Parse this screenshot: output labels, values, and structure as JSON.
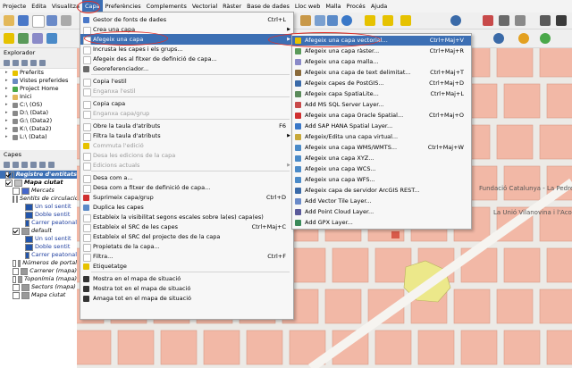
{
  "menubar": {
    "items": [
      "Projecte",
      "Edita",
      "Visualitza",
      "Capa",
      "Preferències",
      "Complements",
      "Vectorial",
      "Ràster",
      "Base de dades",
      "Lloc web",
      "Malla",
      "Procés",
      "Ajuda"
    ],
    "active": "Capa"
  },
  "browser": {
    "title": "Explorador",
    "items": [
      {
        "label": "Preferits",
        "icon": "star-icon",
        "color": "#e6c200"
      },
      {
        "label": "Vistes preferides",
        "icon": "spatial-bookmarks-icon",
        "color": "#6a8ac0"
      },
      {
        "label": "Project Home",
        "icon": "folder-green-icon",
        "color": "#4aa84a"
      },
      {
        "label": "Inici",
        "icon": "folder-icon",
        "color": "#e3b85a"
      },
      {
        "label": "C:\\ (OS)",
        "icon": "drive-icon",
        "color": "#888888"
      },
      {
        "label": "D:\\ (Data)",
        "icon": "drive-icon",
        "color": "#888888"
      },
      {
        "label": "G:\\ (Data2)",
        "icon": "drive-icon",
        "color": "#888888"
      },
      {
        "label": "K:\\ (Data2)",
        "icon": "drive-icon",
        "color": "#888888"
      },
      {
        "label": "L:\\ (Data)",
        "icon": "drive-icon",
        "color": "#888888"
      }
    ]
  },
  "layers": {
    "title": "Capes",
    "rows": [
      {
        "label": "Registre d'entitats",
        "style": "sel bold italic",
        "indent": 6,
        "checked": true,
        "swatch": "#3c6fb4"
      },
      {
        "label": "Mapa ciutat",
        "style": "bold italic",
        "indent": 6,
        "checked": true,
        "swatch": "#c0c0c0"
      },
      {
        "label": "Mercats",
        "style": "italic",
        "indent": 14,
        "checked": false,
        "swatch": "#4466cc"
      },
      {
        "label": "Sentits de circulació",
        "style": "italic",
        "indent": 14,
        "checked": false,
        "swatch": "#999999"
      },
      {
        "label": "Un sol sentit",
        "style": "blue",
        "indent": 28,
        "checked": null,
        "swatch": "#2255aa"
      },
      {
        "label": "Doble sentit",
        "style": "blue",
        "indent": 28,
        "checked": null,
        "swatch": "#2255aa"
      },
      {
        "label": "Carrer peatonal",
        "style": "blue",
        "indent": 28,
        "checked": null,
        "swatch": "#2255aa"
      },
      {
        "label": "default",
        "style": "italic",
        "indent": 14,
        "checked": true,
        "swatch": "#999999"
      },
      {
        "label": "Un sol sentit",
        "style": "blue",
        "indent": 28,
        "checked": null,
        "swatch": "#2255aa"
      },
      {
        "label": "Doble sentit",
        "style": "blue",
        "indent": 28,
        "checked": null,
        "swatch": "#2255aa"
      },
      {
        "label": "Carrer peatonal",
        "style": "blue",
        "indent": 28,
        "checked": null,
        "swatch": "#2255aa"
      },
      {
        "label": "Números de portal",
        "style": "italic",
        "indent": 14,
        "checked": false,
        "swatch": "#999999"
      },
      {
        "label": "Carrerer (mapa)",
        "style": "italic",
        "indent": 14,
        "checked": false,
        "swatch": "#999999"
      },
      {
        "label": "Toponímia (mapa)",
        "style": "italic",
        "indent": 14,
        "checked": false,
        "swatch": "#999999"
      },
      {
        "label": "Sectors (mapa)",
        "style": "italic",
        "indent": 14,
        "checked": false,
        "swatch": "#999999"
      },
      {
        "label": "Mapa ciutat",
        "style": "italic",
        "indent": 14,
        "checked": false,
        "swatch": "#999999"
      }
    ]
  },
  "capa_menu": {
    "items": [
      {
        "type": "item",
        "label": "Gestor de fonts de dades",
        "shortcut": "Ctrl+L",
        "icon": "data-source-manager-icon",
        "color": "#4a78c8"
      },
      {
        "type": "item",
        "label": "Crea una capa",
        "shortcut": "",
        "icon": "new-layer-icon",
        "color": "#ffffff",
        "submenu": true
      },
      {
        "type": "item",
        "label": "Afegeix una capa",
        "shortcut": "",
        "icon": "add-layer-icon",
        "color": "#ffffff",
        "submenu": true,
        "highlight": true
      },
      {
        "type": "item",
        "label": "Incrusta les capes i els grups...",
        "shortcut": "",
        "icon": "embed-icon",
        "color": "#ffffff"
      },
      {
        "type": "item",
        "label": "Afegeix des al fitxer de definició de capa...",
        "shortcut": "",
        "icon": "layer-definition-icon",
        "color": "#ffffff"
      },
      {
        "type": "item",
        "label": "Georeferenciador...",
        "shortcut": "",
        "icon": "georeferencer-icon",
        "color": "#6a6a6a"
      },
      {
        "type": "sep"
      },
      {
        "type": "item",
        "label": "Copia l'estil",
        "shortcut": "",
        "icon": "copy-style-icon",
        "color": "#ffffff"
      },
      {
        "type": "item",
        "label": "Enganxa l'estil",
        "shortcut": "",
        "icon": "paste-style-icon",
        "color": "#ffffff",
        "disabled": true
      },
      {
        "type": "sep"
      },
      {
        "type": "item",
        "label": "Copia capa",
        "shortcut": "",
        "icon": "copy-layer-icon",
        "color": "#ffffff"
      },
      {
        "type": "item",
        "label": "Enganxa capa/grup",
        "shortcut": "",
        "icon": "paste-layer-icon",
        "color": "#ffffff",
        "disabled": true
      },
      {
        "type": "sep"
      },
      {
        "type": "item",
        "label": "Obre la taula d'atributs",
        "shortcut": "F6",
        "icon": "attribute-table-icon",
        "color": "#ffffff"
      },
      {
        "type": "item",
        "label": "Filtra la taula d'atributs",
        "shortcut": "",
        "icon": "filter-table-icon",
        "color": "#ffffff",
        "submenu": true
      },
      {
        "type": "item",
        "label": "Commuta l'edició",
        "shortcut": "",
        "icon": "toggle-edit-icon",
        "color": "#e6c200",
        "disabled": true
      },
      {
        "type": "item",
        "label": "Desa les edicions de la capa",
        "shortcut": "",
        "icon": "save-edits-icon",
        "color": "#ffffff",
        "disabled": true
      },
      {
        "type": "item",
        "label": "Edicions actuals",
        "shortcut": "",
        "icon": "current-edits-icon",
        "color": "#ffffff",
        "disabled": true,
        "submenu": true
      },
      {
        "type": "sep"
      },
      {
        "type": "item",
        "label": "Desa com a...",
        "shortcut": "",
        "icon": "save-as-icon",
        "color": "#ffffff"
      },
      {
        "type": "item",
        "label": "Desa com a fitxer de definició de capa...",
        "shortcut": "",
        "icon": "save-definition-icon",
        "color": "#ffffff"
      },
      {
        "type": "item",
        "label": "Suprimeix capa/grup",
        "shortcut": "Ctrl+D",
        "icon": "remove-layer-icon",
        "color": "#d03030"
      },
      {
        "type": "item",
        "label": "Duplica les capes",
        "shortcut": "",
        "icon": "duplicate-layer-icon",
        "color": "#5a8ac8"
      },
      {
        "type": "item",
        "label": "Estableix la visibilitat segons escales sobre la(es) capa(es)",
        "shortcut": "",
        "icon": "scale-visibility-icon",
        "color": "#ffffff"
      },
      {
        "type": "item",
        "label": "Estableix el SRC de les capes",
        "shortcut": "Ctrl+Maj+C",
        "icon": "set-crs-icon",
        "color": "#ffffff"
      },
      {
        "type": "item",
        "label": "Estableix el SRC del projecte des de la capa",
        "shortcut": "",
        "icon": "project-crs-icon",
        "color": "#ffffff"
      },
      {
        "type": "item",
        "label": "Propietats de la capa...",
        "shortcut": "",
        "icon": "layer-properties-icon",
        "color": "#ffffff"
      },
      {
        "type": "item",
        "label": "Filtra...",
        "shortcut": "Ctrl+F",
        "icon": "filter-icon",
        "color": "#ffffff"
      },
      {
        "type": "item",
        "label": "Etiquetatge",
        "shortcut": "",
        "icon": "labeling-icon",
        "color": "#e6c200"
      },
      {
        "type": "sep"
      },
      {
        "type": "item",
        "label": "Mostra en el mapa de situació",
        "shortcut": "",
        "icon": "show-overview-icon",
        "color": "#333333"
      },
      {
        "type": "item",
        "label": "Mostra tot en el mapa de situació",
        "shortcut": "",
        "icon": "show-all-overview-icon",
        "color": "#333333"
      },
      {
        "type": "item",
        "label": "Amaga tot en el mapa de situació",
        "shortcut": "",
        "icon": "hide-all-overview-icon",
        "color": "#333333"
      }
    ]
  },
  "submenu": {
    "items": [
      {
        "label": "Afegeix una capa vectorial...",
        "shortcut": "Ctrl+Maj+V",
        "icon": "vector-layer-icon",
        "color": "#e6c200",
        "highlight": true
      },
      {
        "label": "Afegeix una capa ràster...",
        "shortcut": "Ctrl+Maj+R",
        "icon": "raster-layer-icon",
        "color": "#5a9a5a"
      },
      {
        "label": "Afegeix una capa malla...",
        "shortcut": "",
        "icon": "mesh-layer-icon",
        "color": "#8a8ac8"
      },
      {
        "label": "Afegeix una capa de text delimitat...",
        "shortcut": "Ctrl+Maj+T",
        "icon": "delimited-text-icon",
        "color": "#8a6a3a"
      },
      {
        "label": "Afegeix capes de PostGIS...",
        "shortcut": "Ctrl+Maj+D",
        "icon": "postgis-icon",
        "color": "#3a6aa8"
      },
      {
        "label": "Afegeix capa SpatiaLite...",
        "shortcut": "Ctrl+Maj+L",
        "icon": "spatialite-icon",
        "color": "#5a8a5a"
      },
      {
        "label": "Add MS SQL Server Layer...",
        "shortcut": "",
        "icon": "mssql-icon",
        "color": "#c84a4a"
      },
      {
        "label": "Afegeix una capa Oracle Spatial...",
        "shortcut": "Ctrl+Maj+O",
        "icon": "oracle-icon",
        "color": "#d03030"
      },
      {
        "label": "Add SAP HANA Spatial Layer...",
        "shortcut": "",
        "icon": "hana-icon",
        "color": "#3a78c8"
      },
      {
        "label": "Afegeix/Edita una capa virtual...",
        "shortcut": "",
        "icon": "virtual-layer-icon",
        "color": "#c8a83a"
      },
      {
        "label": "Afegeix una capa WMS/WMTS...",
        "shortcut": "Ctrl+Maj+W",
        "icon": "wms-icon",
        "color": "#4a8ac8"
      },
      {
        "label": "Afegeix una capa XYZ...",
        "shortcut": "",
        "icon": "xyz-icon",
        "color": "#4a8ac8"
      },
      {
        "label": "Afegeix una capa WCS...",
        "shortcut": "",
        "icon": "wcs-icon",
        "color": "#4a8ac8"
      },
      {
        "label": "Afegeix una capa WFS...",
        "shortcut": "",
        "icon": "wfs-icon",
        "color": "#4a8ac8"
      },
      {
        "label": "Afegeix capa de servidor ArcGIS REST...",
        "shortcut": "",
        "icon": "arcgis-icon",
        "color": "#3a6aa8"
      },
      {
        "label": "Add Vector Tile Layer...",
        "shortcut": "",
        "icon": "vector-tile-icon",
        "color": "#6a8ac8"
      },
      {
        "label": "Add Point Cloud Layer...",
        "shortcut": "",
        "icon": "point-cloud-icon",
        "color": "#5a5a9a"
      },
      {
        "label": "Add GPX Layer...",
        "shortcut": "",
        "icon": "gpx-icon",
        "color": "#3a8a5a"
      }
    ]
  },
  "map": {
    "labels": [
      {
        "text": "Fundació Catalunya - La Pedrera. I"
      },
      {
        "text": "La Unió Vilanovina i l'Acord i e"
      }
    ],
    "colors": {
      "block": "#f2b8a6",
      "block_border": "#d89a88",
      "road": "#f6f4f0",
      "park": "#ece88a"
    }
  }
}
